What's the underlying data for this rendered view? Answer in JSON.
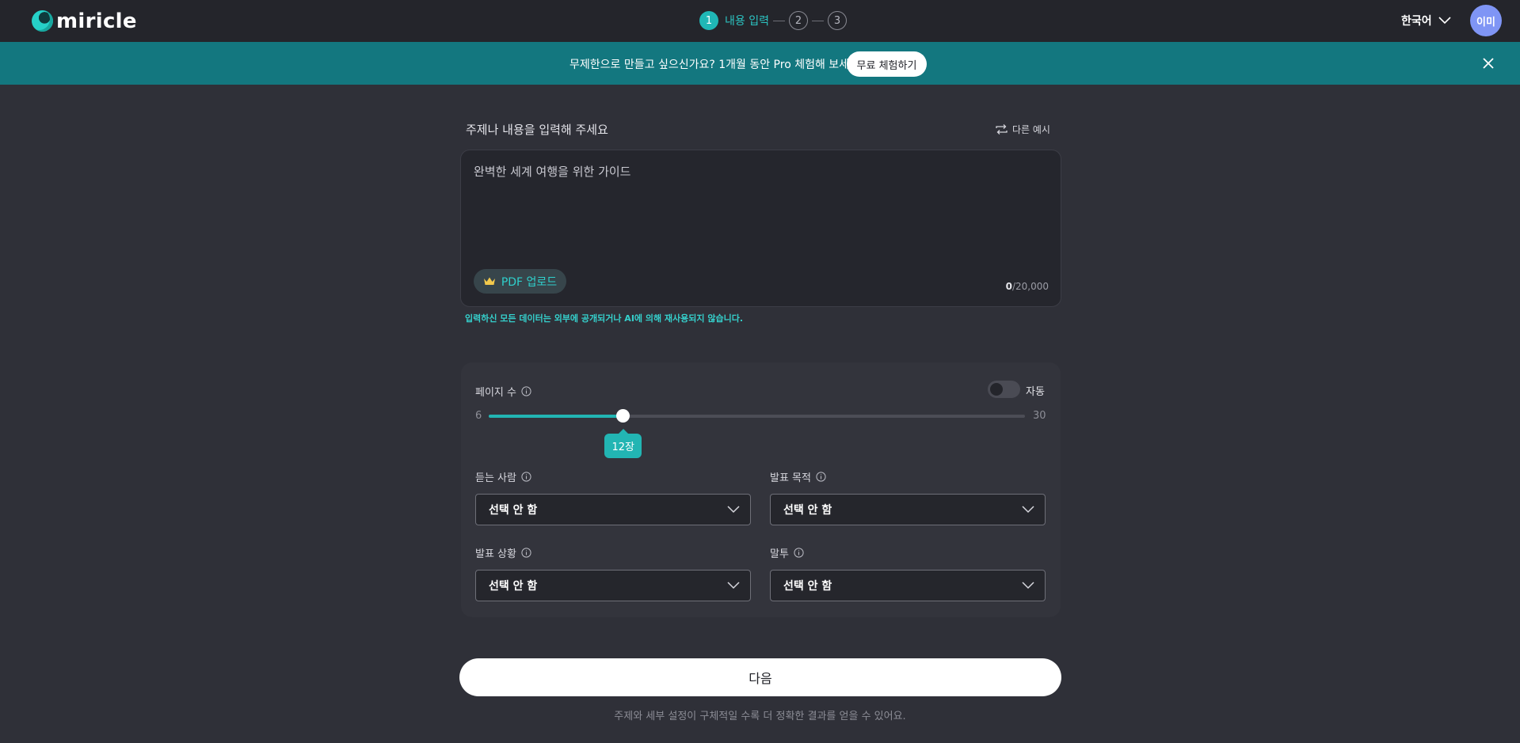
{
  "header": {
    "logo_text": "miricle",
    "steps": [
      {
        "number": "1",
        "label": "내용 입력",
        "active": true
      },
      {
        "number": "2",
        "label": "",
        "active": false
      },
      {
        "number": "3",
        "label": "",
        "active": false
      }
    ],
    "language": "한국어",
    "avatar_text": "이미"
  },
  "banner": {
    "text": "무제한으로 만들고 싶으신가요? 1개월 동안 Pro 체험해 보세요!",
    "button_label": "무료 체험하기"
  },
  "prompt": {
    "title": "주제나 내용을 입력해 주세요",
    "other_example_label": "다른 예시",
    "placeholder": "완벽한 세계 여행을 위한 가이드",
    "value": "",
    "pdf_button_label": "PDF 업로드",
    "char_count_current": "0",
    "char_count_max": "/20,000",
    "privacy_note": "입력하신 모든 데이터는 외부에 공개되거나 AI에 의해 재사용되지 않습니다."
  },
  "settings": {
    "page_count_label": "페이지 수",
    "auto_label": "자동",
    "auto_enabled": false,
    "slider_min": "6",
    "slider_max": "30",
    "slider_value": 12,
    "slider_value_label": "12장",
    "audience_label": "듣는 사람",
    "audience_value": "선택 안 함",
    "purpose_label": "발표 목적",
    "purpose_value": "선택 안 함",
    "situation_label": "발표 상황",
    "situation_value": "선택 안 함",
    "tone_label": "말투",
    "tone_value": "선택 안 함"
  },
  "footer": {
    "next_label": "다음",
    "hint": "주제와 세부 설정이 구체적일 수록 더 정확한 결과를 얻을 수 있어요."
  },
  "colors": {
    "accent": "#22b5b3",
    "banner": "#13777f",
    "background": "#2f3038",
    "avatar": "#7f95f5"
  }
}
